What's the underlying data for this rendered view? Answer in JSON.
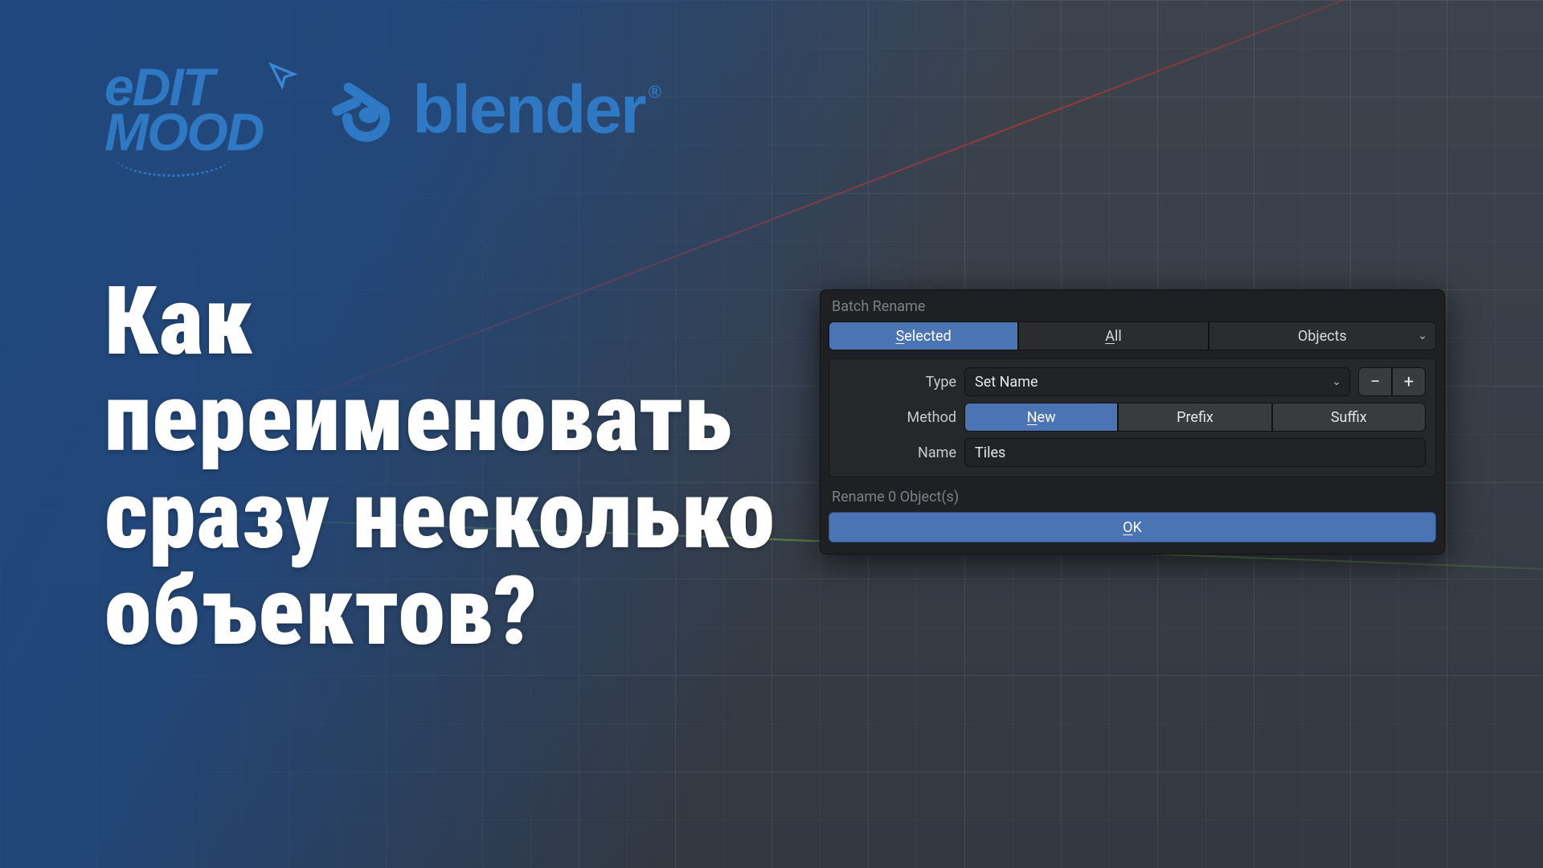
{
  "logos": {
    "edit_mood_line1": "eDIT",
    "edit_mood_line2": "MOOD",
    "blender": "blender"
  },
  "headline": "Как переименовать сразу несколько объектов?",
  "dialog": {
    "title": "Batch Rename",
    "scope": {
      "selected": "Selected",
      "all": "All",
      "datatype": "Objects"
    },
    "rows": {
      "type_label": "Type",
      "type_value": "Set Name",
      "method_label": "Method",
      "method_options": {
        "new": "New",
        "prefix": "Prefix",
        "suffix": "Suffix"
      },
      "name_label": "Name",
      "name_value": "Tiles"
    },
    "steppers": {
      "minus": "−",
      "plus": "+"
    },
    "status": "Rename 0 Object(s)",
    "ok": "OK"
  }
}
